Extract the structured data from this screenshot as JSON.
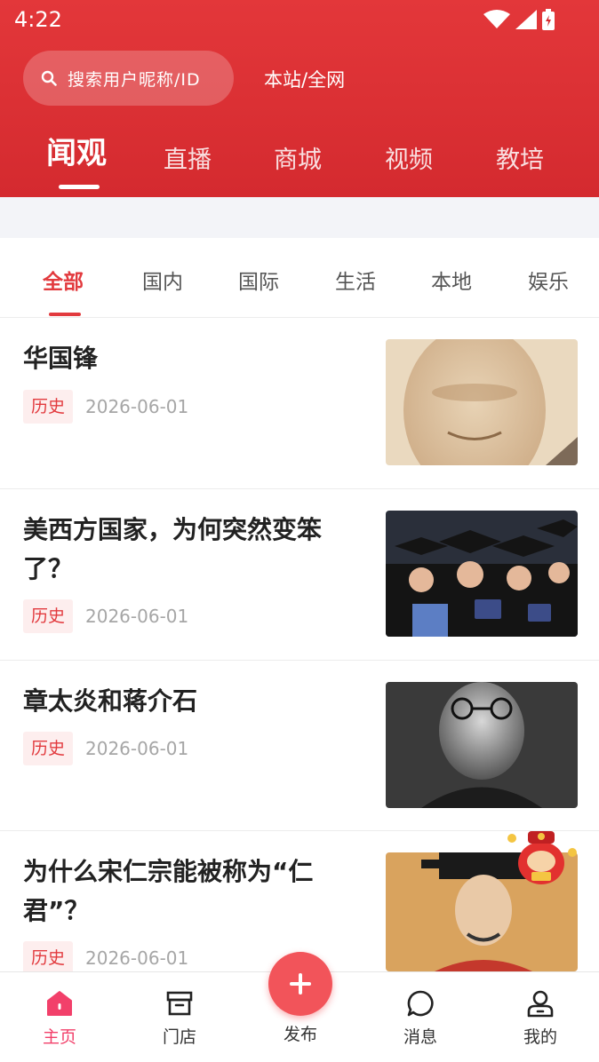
{
  "status_bar": {
    "time": "4:22"
  },
  "header": {
    "search_placeholder": "搜索用户昵称/ID",
    "scope_label": "本站/全网",
    "main_tabs": [
      {
        "label": "闻观",
        "active": true
      },
      {
        "label": "直播",
        "active": false
      },
      {
        "label": "商城",
        "active": false
      },
      {
        "label": "视频",
        "active": false
      },
      {
        "label": "教培",
        "active": false
      }
    ]
  },
  "categories": [
    {
      "label": "全部",
      "active": true
    },
    {
      "label": "国内",
      "active": false
    },
    {
      "label": "国际",
      "active": false
    },
    {
      "label": "生活",
      "active": false
    },
    {
      "label": "本地",
      "active": false
    },
    {
      "label": "娱乐",
      "active": false
    }
  ],
  "news": [
    {
      "title": "华国锋",
      "tag": "历史",
      "date": "2026-06-01"
    },
    {
      "title": "美西方国家，为何突然变笨了？",
      "tag": "历史",
      "date": "2026-06-01"
    },
    {
      "title": "章太炎和蒋介石",
      "tag": "历史",
      "date": "2026-06-01"
    },
    {
      "title": "为什么宋仁宗能被称为“仁君”？",
      "tag": "历史",
      "date": "2026-06-01"
    }
  ],
  "bottom_nav": {
    "items": [
      {
        "label": "主页",
        "icon": "home-icon",
        "active": true
      },
      {
        "label": "门店",
        "icon": "store-icon",
        "active": false
      },
      {
        "label": "消息",
        "icon": "message-icon",
        "active": false
      },
      {
        "label": "我的",
        "icon": "profile-icon",
        "active": false
      }
    ],
    "publish_label": "发布"
  },
  "colors": {
    "primary": "#e23a3e",
    "nav_active": "#f2406a",
    "fab": "#f2545a"
  }
}
